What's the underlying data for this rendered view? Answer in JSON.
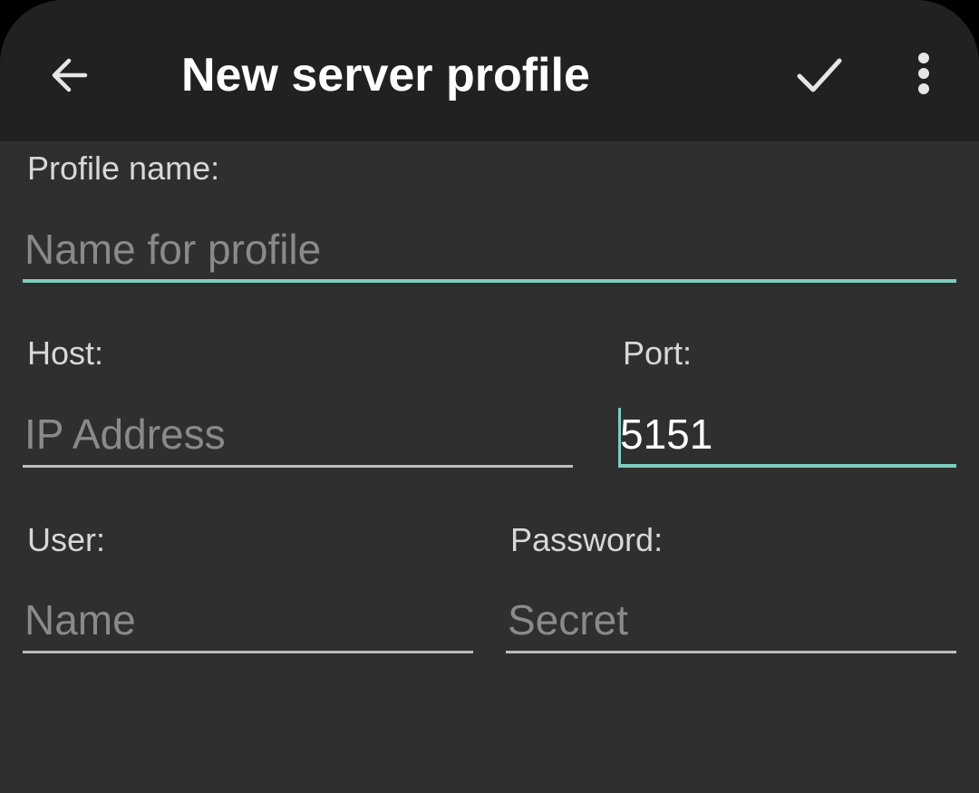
{
  "appbar": {
    "title": "New server profile",
    "back_icon": "arrow-left-icon",
    "confirm_icon": "check-icon",
    "menu_icon": "more-vert-icon"
  },
  "form": {
    "profile_name": {
      "label": "Profile name:",
      "placeholder": "Name for profile",
      "value": ""
    },
    "host": {
      "label": "Host:",
      "placeholder": "IP Address",
      "value": ""
    },
    "port": {
      "label": "Port:",
      "placeholder": "",
      "value": "5151"
    },
    "user": {
      "label": "User:",
      "placeholder": "Name",
      "value": ""
    },
    "password": {
      "label": "Password:",
      "placeholder": "Secret",
      "value": ""
    }
  },
  "colors": {
    "accent": "#7fcdc1",
    "appbar_bg": "#212121",
    "screen_bg": "#2f2f2f",
    "placeholder": "#8a8a8a"
  }
}
